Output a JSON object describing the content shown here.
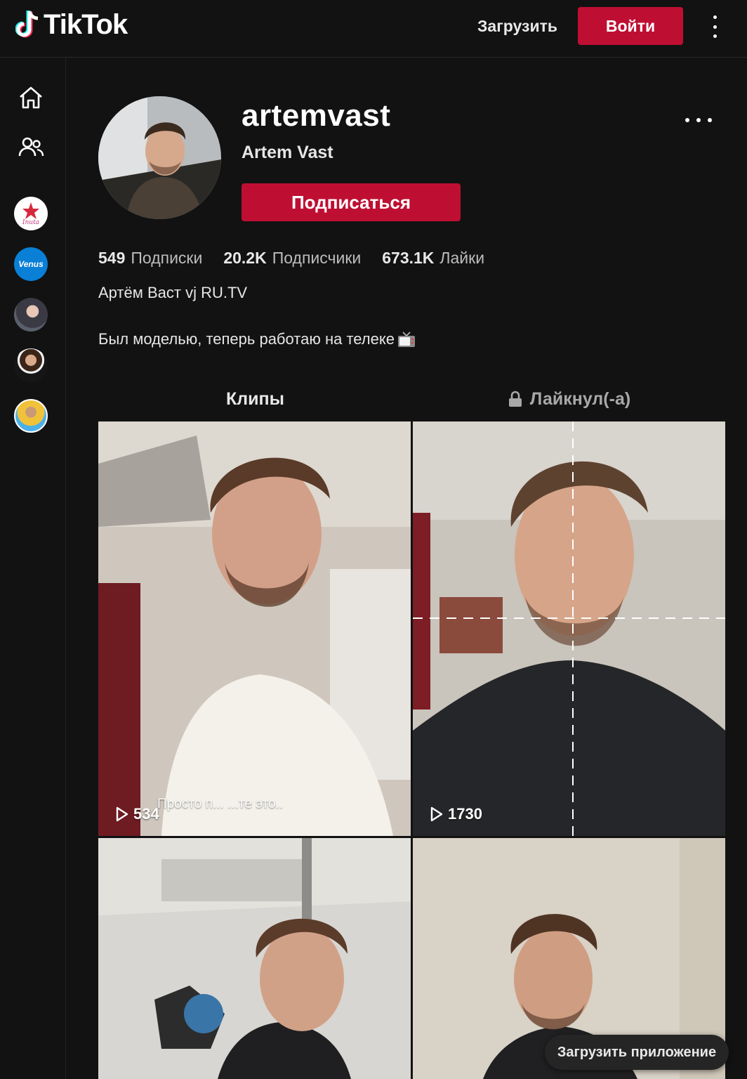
{
  "header": {
    "logo_text": "TikTok",
    "upload_label": "Загрузить",
    "login_label": "Войти",
    "menu_icon": "more-vertical-icon"
  },
  "sidebar": {
    "nav": [
      {
        "icon": "home-icon"
      },
      {
        "icon": "following-icon"
      }
    ],
    "accounts": [
      {
        "icon": "avatar-inuta",
        "label": "Inuta"
      },
      {
        "icon": "avatar-venus",
        "label": "Venus"
      },
      {
        "icon": "avatar-girl"
      },
      {
        "icon": "avatar-man-suit"
      },
      {
        "icon": "avatar-man-yellow"
      }
    ]
  },
  "profile": {
    "username": "artemvast",
    "display_name": "Artem Vast",
    "follow_label": "Подписаться",
    "more_icon": "more-horizontal-icon",
    "stats": [
      {
        "value": "549",
        "label": "Подписки"
      },
      {
        "value": "20.2K",
        "label": "Подписчики"
      },
      {
        "value": "673.1K",
        "label": "Лайки"
      }
    ],
    "bio_line1": "Артём Васт vj RU.TV",
    "bio_line2": "Был моделью, теперь работаю на телеке",
    "bio_emoji_icon": "tv-icon"
  },
  "tabs": [
    {
      "label": "Клипы",
      "active": true
    },
    {
      "label": "Лайкнул(-а)",
      "active": false,
      "icon": "lock-icon"
    }
  ],
  "videos": [
    {
      "views": "534",
      "caption": "Просто п... ...те это.."
    },
    {
      "views": "1730",
      "caption": ""
    },
    {
      "views": "",
      "caption": ""
    },
    {
      "views": "",
      "caption": ""
    }
  ],
  "download_app_label": "Загрузить приложение",
  "colors": {
    "brand_red": "#be0f33",
    "background": "#121212"
  }
}
